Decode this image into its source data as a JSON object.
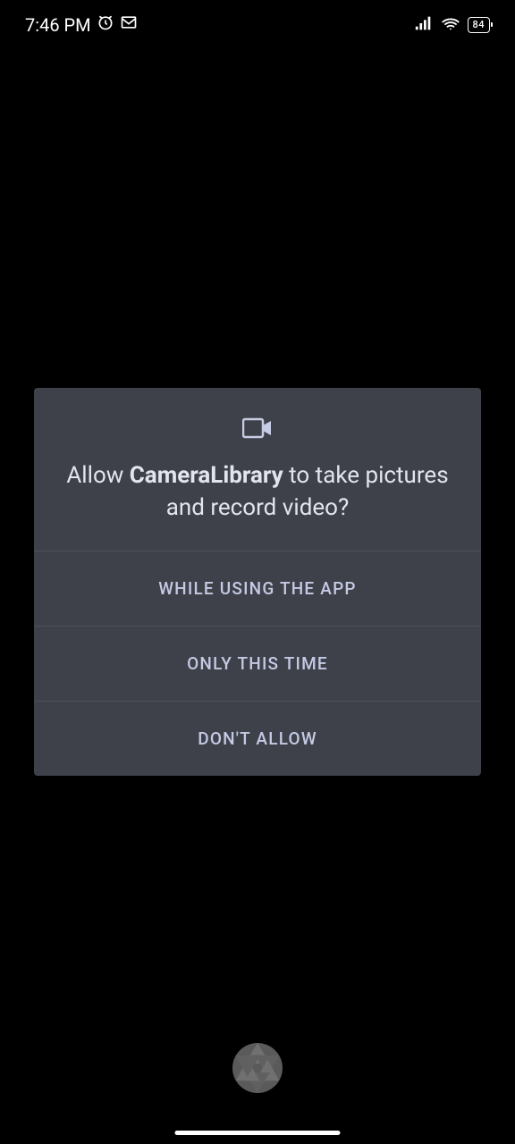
{
  "status_bar": {
    "time": "7:46 PM",
    "battery_level": "84"
  },
  "dialog": {
    "title_prefix": "Allow ",
    "app_name": "CameraLibrary",
    "title_suffix": " to take pictures and record video?",
    "button_while_using": "WHILE USING THE APP",
    "button_only_this_time": "ONLY THIS TIME",
    "button_dont_allow": "DON'T ALLOW"
  }
}
